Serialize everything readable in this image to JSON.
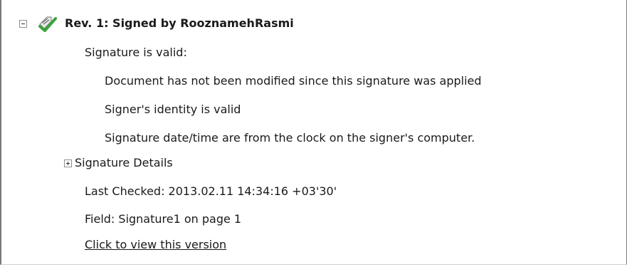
{
  "signature_panel": {
    "revision_title": "Rev. 1: Signed by RooznamehRasmi",
    "status_heading": "Signature is valid:",
    "status_details": [
      "Document has not been modified since this signature was applied",
      "Signer's identity is valid",
      "Signature date/time are from the clock on the signer's computer."
    ],
    "details_label": "Signature Details",
    "last_checked": "Last Checked: 2013.02.11 14:34:16 +03'30'",
    "field": "Field: Signature1 on page 1",
    "view_version_link": "Click to view this version"
  },
  "icons": {
    "revision_toggle": "collapse-minus-icon",
    "signature_status": "signature-valid-check-icon",
    "details_toggle": "expand-plus-icon"
  },
  "colors": {
    "check_green": "#3aa33a",
    "pen_gray": "#8a8a8a",
    "frame_border": "#7a7a7a"
  }
}
